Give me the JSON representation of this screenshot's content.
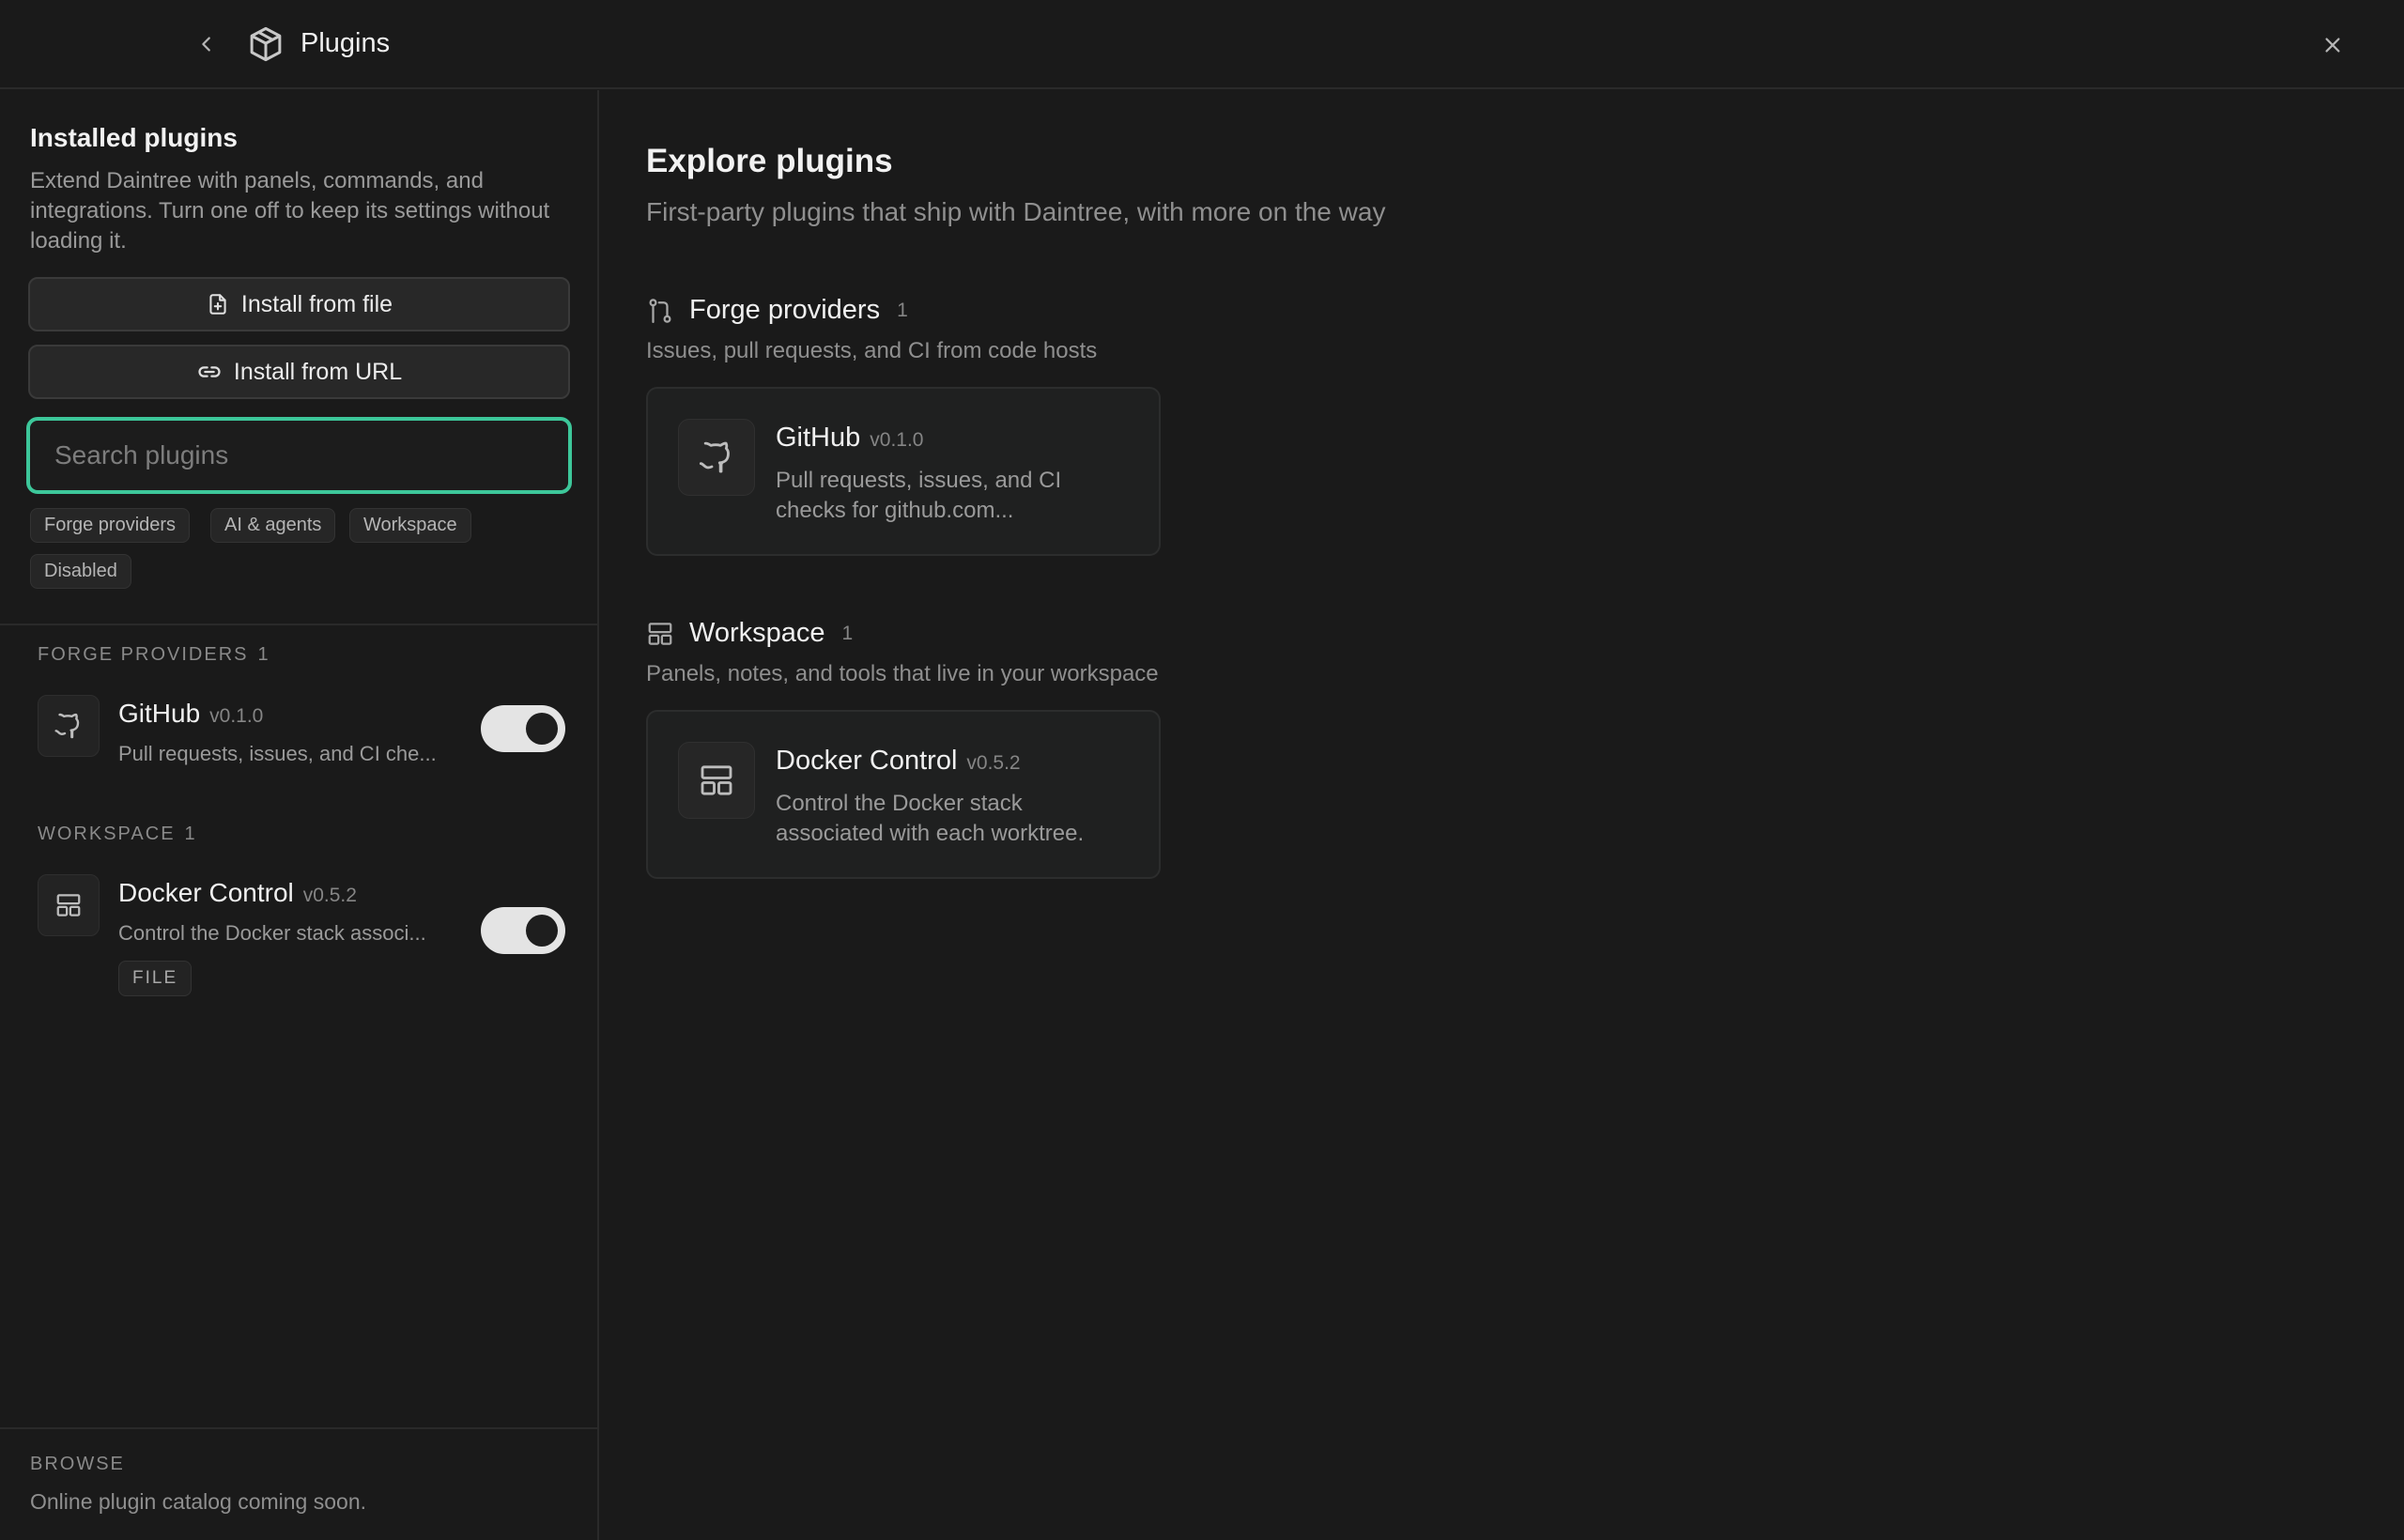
{
  "header": {
    "title": "Plugins",
    "back_icon": "chevron-left-icon",
    "app_icon": "package-icon",
    "close_icon": "close-icon"
  },
  "sidebar": {
    "title": "Installed plugins",
    "description": "Extend Daintree with panels, commands, and integrations. Turn one off to keep its settings without loading it.",
    "install_file_label": "Install from file",
    "install_url_label": "Install from URL",
    "search": {
      "placeholder": "Search plugins",
      "value": ""
    },
    "filters": [
      "Forge providers",
      "AI & agents",
      "Workspace",
      "Disabled"
    ],
    "groups": [
      {
        "label": "FORGE PROVIDERS",
        "count": "1",
        "items": [
          {
            "name": "GitHub",
            "version": "v0.1.0",
            "description": "Pull requests, issues, and CI che...",
            "icon": "github-icon",
            "enabled": true,
            "badge": ""
          }
        ]
      },
      {
        "label": "WORKSPACE",
        "count": "1",
        "items": [
          {
            "name": "Docker Control",
            "version": "v0.5.2",
            "description": "Control the Docker stack associ...",
            "icon": "layout-icon",
            "enabled": true,
            "badge": "FILE"
          }
        ]
      }
    ],
    "browse": {
      "label": "BROWSE",
      "description": "Online plugin catalog coming soon."
    }
  },
  "main": {
    "title": "Explore plugins",
    "subtitle": "First-party plugins that ship with Daintree, with more on the way",
    "sections": [
      {
        "title": "Forge providers",
        "count": "1",
        "description": "Issues, pull requests, and CI from code hosts",
        "icon": "git-pull-request-icon",
        "cards": [
          {
            "name": "GitHub",
            "version": "v0.1.0",
            "description": "Pull requests, issues, and CI checks for github.com...",
            "icon": "github-icon"
          }
        ]
      },
      {
        "title": "Workspace",
        "count": "1",
        "description": "Panels, notes, and tools that live in your workspace",
        "icon": "layout-icon",
        "cards": [
          {
            "name": "Docker Control",
            "version": "v0.5.2",
            "description": "Control the Docker stack associated with each worktree.",
            "icon": "layout-icon"
          }
        ]
      }
    ]
  },
  "colors": {
    "background": "#1a1a1a",
    "accent": "#3dc79a",
    "toggle_on": "#e4e4e4"
  }
}
